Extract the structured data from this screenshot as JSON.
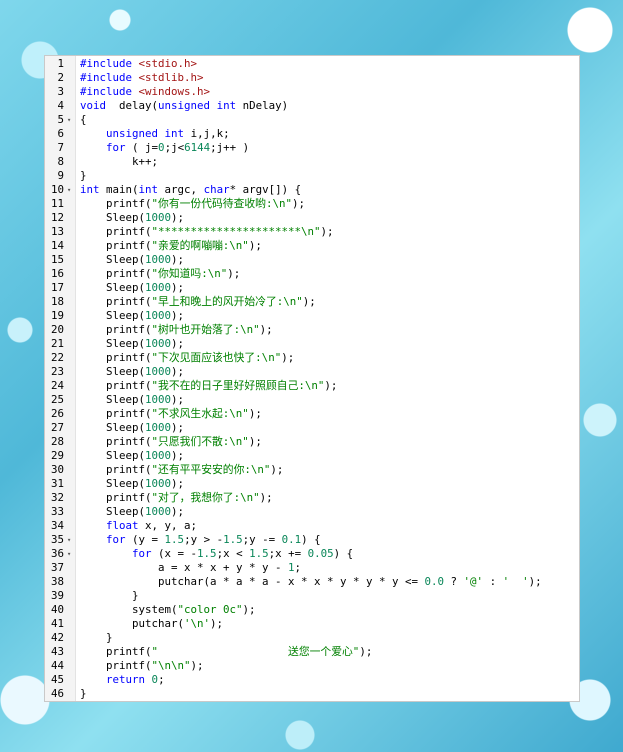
{
  "editor": {
    "lines": [
      {
        "n": "1",
        "fold": "",
        "segs": [
          [
            "pp",
            "#include "
          ],
          [
            "ang",
            "<stdio.h>"
          ]
        ]
      },
      {
        "n": "2",
        "fold": "",
        "segs": [
          [
            "pp",
            "#include "
          ],
          [
            "ang",
            "<stdlib.h>"
          ]
        ]
      },
      {
        "n": "3",
        "fold": "",
        "segs": [
          [
            "pp",
            "#include "
          ],
          [
            "ang",
            "<windows.h>"
          ]
        ]
      },
      {
        "n": "4",
        "fold": "",
        "segs": [
          [
            "kw",
            "void"
          ],
          [
            "",
            "  delay("
          ],
          [
            "kw",
            "unsigned"
          ],
          [
            "",
            " "
          ],
          [
            "kw",
            "int"
          ],
          [
            "",
            " nDelay)"
          ]
        ]
      },
      {
        "n": "5",
        "fold": "▾",
        "segs": [
          [
            "",
            "{"
          ]
        ]
      },
      {
        "n": "6",
        "fold": "",
        "segs": [
          [
            "",
            "    "
          ],
          [
            "kw",
            "unsigned"
          ],
          [
            "",
            " "
          ],
          [
            "kw",
            "int"
          ],
          [
            "",
            " i,j,k;"
          ]
        ]
      },
      {
        "n": "7",
        "fold": "",
        "segs": [
          [
            "",
            "    "
          ],
          [
            "kw",
            "for"
          ],
          [
            "",
            " ( j="
          ],
          [
            "num",
            "0"
          ],
          [
            "",
            ";j<"
          ],
          [
            "num",
            "6144"
          ],
          [
            "",
            ";j++ )"
          ]
        ]
      },
      {
        "n": "8",
        "fold": "",
        "segs": [
          [
            "",
            "        k++;"
          ]
        ]
      },
      {
        "n": "9",
        "fold": "",
        "segs": [
          [
            "",
            "}"
          ]
        ]
      },
      {
        "n": "10",
        "fold": "▾",
        "segs": [
          [
            "kw",
            "int"
          ],
          [
            "",
            " main("
          ],
          [
            "kw",
            "int"
          ],
          [
            "",
            " argc, "
          ],
          [
            "kw",
            "char"
          ],
          [
            "",
            "* argv[]) {"
          ]
        ]
      },
      {
        "n": "11",
        "fold": "",
        "segs": [
          [
            "",
            "    printf("
          ],
          [
            "gr",
            "\"你有一份代码待查收哟:\\n\""
          ],
          [
            "",
            ");"
          ]
        ]
      },
      {
        "n": "12",
        "fold": "",
        "segs": [
          [
            "",
            "    Sleep("
          ],
          [
            "num",
            "1000"
          ],
          [
            "",
            ");"
          ]
        ]
      },
      {
        "n": "13",
        "fold": "",
        "segs": [
          [
            "",
            "    printf("
          ],
          [
            "gr",
            "\"**********************\\n\""
          ],
          [
            "",
            ");"
          ]
        ]
      },
      {
        "n": "14",
        "fold": "",
        "segs": [
          [
            "",
            "    printf("
          ],
          [
            "gr",
            "\"亲爱的啊嘣嘣:\\n\""
          ],
          [
            "",
            ");"
          ]
        ]
      },
      {
        "n": "15",
        "fold": "",
        "segs": [
          [
            "",
            "    Sleep("
          ],
          [
            "num",
            "1000"
          ],
          [
            "",
            ");"
          ]
        ]
      },
      {
        "n": "16",
        "fold": "",
        "segs": [
          [
            "",
            "    printf("
          ],
          [
            "gr",
            "\"你知道吗:\\n\""
          ],
          [
            "",
            ");"
          ]
        ]
      },
      {
        "n": "17",
        "fold": "",
        "segs": [
          [
            "",
            "    Sleep("
          ],
          [
            "num",
            "1000"
          ],
          [
            "",
            ");"
          ]
        ]
      },
      {
        "n": "18",
        "fold": "",
        "segs": [
          [
            "",
            "    printf("
          ],
          [
            "gr",
            "\"早上和晚上的风开始冷了:\\n\""
          ],
          [
            "",
            ");"
          ]
        ]
      },
      {
        "n": "19",
        "fold": "",
        "segs": [
          [
            "",
            "    Sleep("
          ],
          [
            "num",
            "1000"
          ],
          [
            "",
            ");"
          ]
        ]
      },
      {
        "n": "20",
        "fold": "",
        "segs": [
          [
            "",
            "    printf("
          ],
          [
            "gr",
            "\"树叶也开始落了:\\n\""
          ],
          [
            "",
            ");"
          ]
        ]
      },
      {
        "n": "21",
        "fold": "",
        "segs": [
          [
            "",
            "    Sleep("
          ],
          [
            "num",
            "1000"
          ],
          [
            "",
            ");"
          ]
        ]
      },
      {
        "n": "22",
        "fold": "",
        "segs": [
          [
            "",
            "    printf("
          ],
          [
            "gr",
            "\"下次见面应该也快了:\\n\""
          ],
          [
            "",
            ");"
          ]
        ]
      },
      {
        "n": "23",
        "fold": "",
        "segs": [
          [
            "",
            "    Sleep("
          ],
          [
            "num",
            "1000"
          ],
          [
            "",
            ");"
          ]
        ]
      },
      {
        "n": "24",
        "fold": "",
        "segs": [
          [
            "",
            "    printf("
          ],
          [
            "gr",
            "\"我不在的日子里好好照顾自己:\\n\""
          ],
          [
            "",
            ");"
          ]
        ]
      },
      {
        "n": "25",
        "fold": "",
        "segs": [
          [
            "",
            "    Sleep("
          ],
          [
            "num",
            "1000"
          ],
          [
            "",
            ");"
          ]
        ]
      },
      {
        "n": "26",
        "fold": "",
        "segs": [
          [
            "",
            "    printf("
          ],
          [
            "gr",
            "\"不求风生水起:\\n\""
          ],
          [
            "",
            ");"
          ]
        ]
      },
      {
        "n": "27",
        "fold": "",
        "segs": [
          [
            "",
            "    Sleep("
          ],
          [
            "num",
            "1000"
          ],
          [
            "",
            ");"
          ]
        ]
      },
      {
        "n": "28",
        "fold": "",
        "segs": [
          [
            "",
            "    printf("
          ],
          [
            "gr",
            "\"只愿我们不散:\\n\""
          ],
          [
            "",
            ");"
          ]
        ]
      },
      {
        "n": "29",
        "fold": "",
        "segs": [
          [
            "",
            "    Sleep("
          ],
          [
            "num",
            "1000"
          ],
          [
            "",
            ");"
          ]
        ]
      },
      {
        "n": "30",
        "fold": "",
        "segs": [
          [
            "",
            "    printf("
          ],
          [
            "gr",
            "\"还有平平安安的你:\\n\""
          ],
          [
            "",
            ");"
          ]
        ]
      },
      {
        "n": "31",
        "fold": "",
        "segs": [
          [
            "",
            "    Sleep("
          ],
          [
            "num",
            "1000"
          ],
          [
            "",
            ");"
          ]
        ]
      },
      {
        "n": "32",
        "fold": "",
        "segs": [
          [
            "",
            "    printf("
          ],
          [
            "gr",
            "\"对了，我想你了:\\n\""
          ],
          [
            "",
            ");"
          ]
        ]
      },
      {
        "n": "33",
        "fold": "",
        "segs": [
          [
            "",
            "    Sleep("
          ],
          [
            "num",
            "1000"
          ],
          [
            "",
            ");"
          ]
        ]
      },
      {
        "n": "34",
        "fold": "",
        "segs": [
          [
            "",
            "    "
          ],
          [
            "kw",
            "float"
          ],
          [
            "",
            " x, y, a;"
          ]
        ]
      },
      {
        "n": "35",
        "fold": "▾",
        "segs": [
          [
            "",
            "    "
          ],
          [
            "kw",
            "for"
          ],
          [
            "",
            " (y = "
          ],
          [
            "num",
            "1.5"
          ],
          [
            "",
            ";y > -"
          ],
          [
            "num",
            "1.5"
          ],
          [
            "",
            ";y -= "
          ],
          [
            "num",
            "0.1"
          ],
          [
            "",
            ") {"
          ]
        ]
      },
      {
        "n": "36",
        "fold": "▾",
        "segs": [
          [
            "",
            "        "
          ],
          [
            "kw",
            "for"
          ],
          [
            "",
            " (x = -"
          ],
          [
            "num",
            "1.5"
          ],
          [
            "",
            ";x < "
          ],
          [
            "num",
            "1.5"
          ],
          [
            "",
            ";x += "
          ],
          [
            "num",
            "0.05"
          ],
          [
            "",
            ") {"
          ]
        ]
      },
      {
        "n": "37",
        "fold": "",
        "segs": [
          [
            "",
            "            a = x * x + y * y - "
          ],
          [
            "num",
            "1"
          ],
          [
            "",
            ";"
          ]
        ]
      },
      {
        "n": "38",
        "fold": "",
        "segs": [
          [
            "",
            "            putchar(a * a * a - x * x * y * y * y <= "
          ],
          [
            "num",
            "0.0"
          ],
          [
            "",
            " ? "
          ],
          [
            "gr",
            "'@'"
          ],
          [
            "",
            " : "
          ],
          [
            "gr",
            "'  '"
          ],
          [
            "",
            ");"
          ]
        ]
      },
      {
        "n": "39",
        "fold": "",
        "segs": [
          [
            "",
            "        }"
          ]
        ]
      },
      {
        "n": "40",
        "fold": "",
        "segs": [
          [
            "",
            "        system("
          ],
          [
            "gr",
            "\"color 0c\""
          ],
          [
            "",
            ");"
          ]
        ]
      },
      {
        "n": "41",
        "fold": "",
        "segs": [
          [
            "",
            "        putchar("
          ],
          [
            "gr",
            "'\\n'"
          ],
          [
            "",
            ");"
          ]
        ]
      },
      {
        "n": "42",
        "fold": "",
        "segs": [
          [
            "",
            "    }"
          ]
        ]
      },
      {
        "n": "43",
        "fold": "",
        "segs": [
          [
            "",
            "    printf("
          ],
          [
            "gr",
            "\"                    送您一个爱心\""
          ],
          [
            "",
            ");"
          ]
        ]
      },
      {
        "n": "44",
        "fold": "",
        "segs": [
          [
            "",
            "    printf("
          ],
          [
            "gr",
            "\"\\n\\n\""
          ],
          [
            "",
            ");"
          ]
        ]
      },
      {
        "n": "45",
        "fold": "",
        "segs": [
          [
            "",
            "    "
          ],
          [
            "kw",
            "return"
          ],
          [
            "",
            " "
          ],
          [
            "num",
            "0"
          ],
          [
            "",
            ";"
          ]
        ]
      },
      {
        "n": "46",
        "fold": "",
        "segs": [
          [
            "",
            "}"
          ]
        ]
      }
    ]
  }
}
